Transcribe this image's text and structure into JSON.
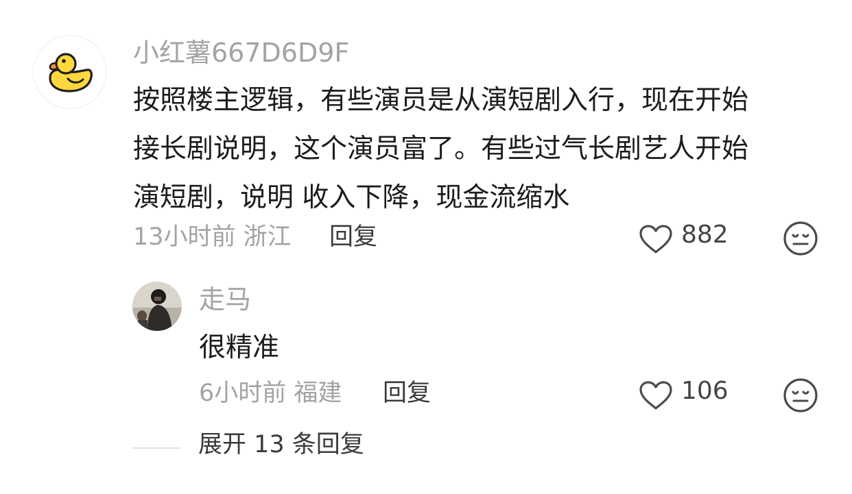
{
  "main_comment": {
    "username": "小红薯667D6D9F",
    "avatar_icon": "duck-icon",
    "text_lines": [
      "按照楼主逻辑，有些演员是从演短剧入行，现在开始",
      "接长剧说明，这个演员富了。有些过气长剧艺人开始",
      "演短剧，说明 收入下降，现金流缩水"
    ],
    "time_location": "13小时前 浙江",
    "reply_label": "回复",
    "like_count": "882",
    "like_icon": "heart-outline-icon",
    "dislike_icon": "meh-face-icon"
  },
  "reply_comment": {
    "username": "走马",
    "avatar_icon": "user-photo-avatar",
    "text": "很精准",
    "time_location": "6小时前 福建",
    "reply_label": "回复",
    "like_count": "106",
    "like_icon": "heart-outline-icon",
    "dislike_icon": "meh-face-icon"
  },
  "expand_replies_label": "展开 13 条回复",
  "colors": {
    "username_gray": "#a3a3a3",
    "text_dark": "#1c1c1c",
    "icon_gray": "#4a4a4a",
    "duck_yellow": "#ffd83d"
  }
}
